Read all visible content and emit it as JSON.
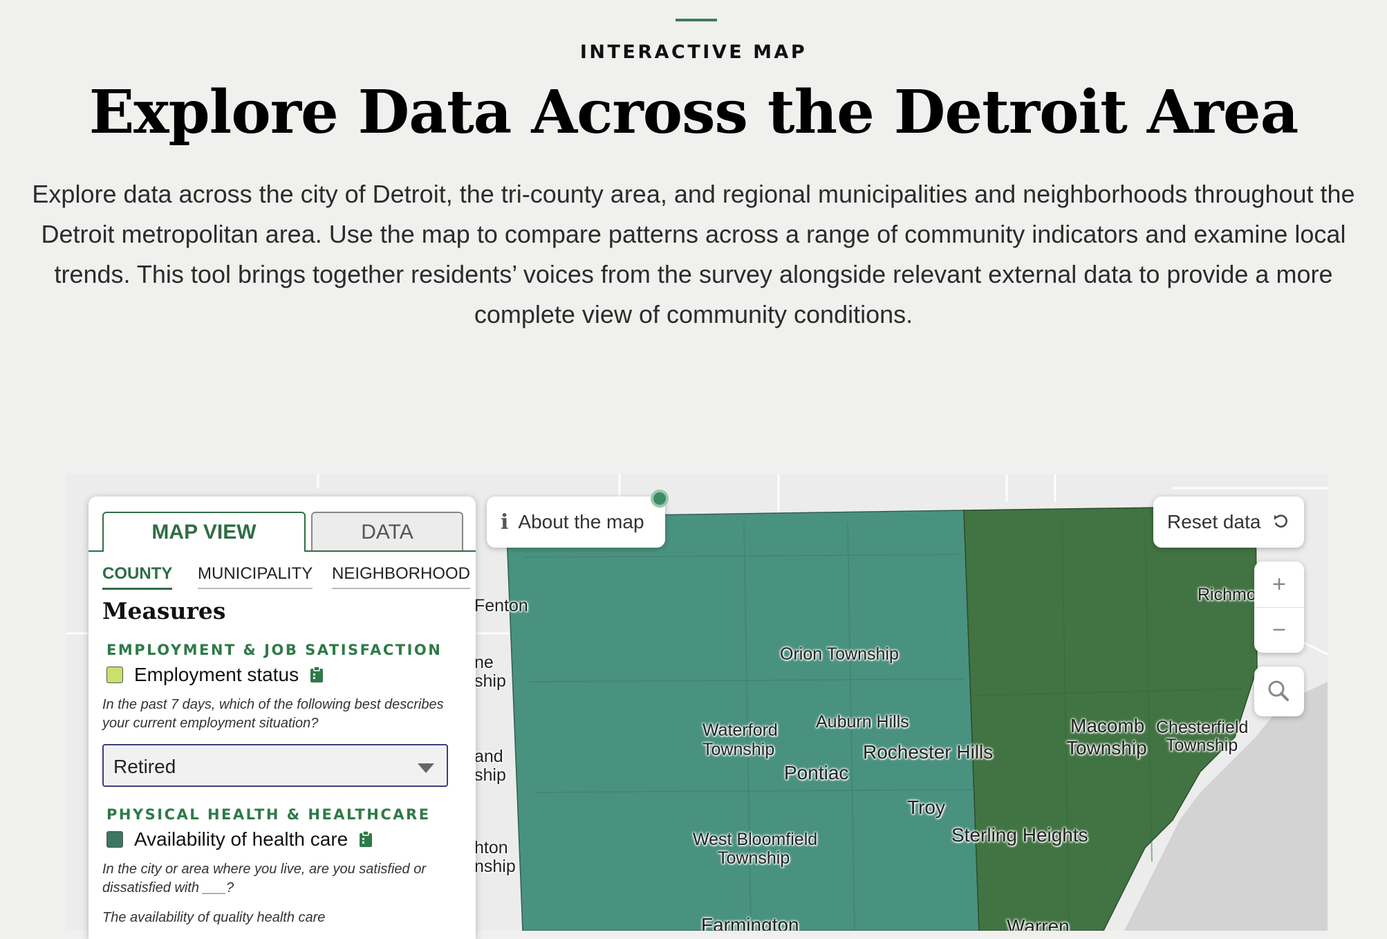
{
  "header": {
    "eyebrow": "INTERACTIVE MAP",
    "title": "Explore Data Across the Detroit Area",
    "intro": "Explore data across the city of Detroit, the tri-county area, and regional municipalities and neighborhoods throughout the Detroit metropolitan area. Use the map to compare patterns across a range of community indicators and examine local trends. This tool brings together residents’ voices from the survey alongside relevant external data to provide a more complete view of community conditions."
  },
  "panel": {
    "tabs": {
      "map_view": "MAP VIEW",
      "data": "DATA"
    },
    "subtabs": {
      "county": "COUNTY",
      "municipality": "MUNICIPALITY",
      "neighborhood": "NEIGHBORHOOD"
    },
    "measures_title": "Measures",
    "categories": [
      {
        "title": "EMPLOYMENT & JOB SATISFACTION",
        "measure": "Employment status",
        "swatch_color": "#c9e06a",
        "question": "In the past 7 days, which of the following best describes your current employment situation?",
        "selected": "Retired"
      },
      {
        "title": "PHYSICAL HEALTH & HEALTHCARE",
        "measure": "Availability of health care",
        "swatch_color": "#3e7563",
        "question": "In the city or area where you live, are you satisfied or dissatisfied with ___?",
        "sub_question": "The availability of quality health care"
      }
    ]
  },
  "controls": {
    "about_label": "About the map",
    "reset_label": "Reset data",
    "zoom_in": "+",
    "zoom_out": "−",
    "icons": [
      "info-icon",
      "reset-icon",
      "search-icon",
      "clipboard-icon"
    ]
  },
  "colors": {
    "oakland_county": "#4a9280",
    "macomb_county": "#427443",
    "accent": "#2f6d45",
    "lake": "#d3d3d3"
  },
  "map_labels": {
    "fenton": "Fenton",
    "ne_ship": "ne",
    "ne_ship2": "ship",
    "and_ship": "and",
    "and_ship2": "ship",
    "hton": "hton",
    "nship": "nship",
    "orion": "Orion Township",
    "waterford1": "Waterford",
    "waterford2": "Township",
    "auburn": "Auburn Hills",
    "rochester": "Rochester Hills",
    "pontiac": "Pontiac",
    "troy": "Troy",
    "wbloom1": "West Bloomfield",
    "wbloom2": "Township",
    "farmington": "Farmington",
    "sterling": "Sterling Heights",
    "warren": "Warren",
    "macomb1": "Macomb",
    "macomb2": "Township",
    "chester1": "Chesterfield",
    "chester2": "Township",
    "richmond": "Richmo"
  }
}
